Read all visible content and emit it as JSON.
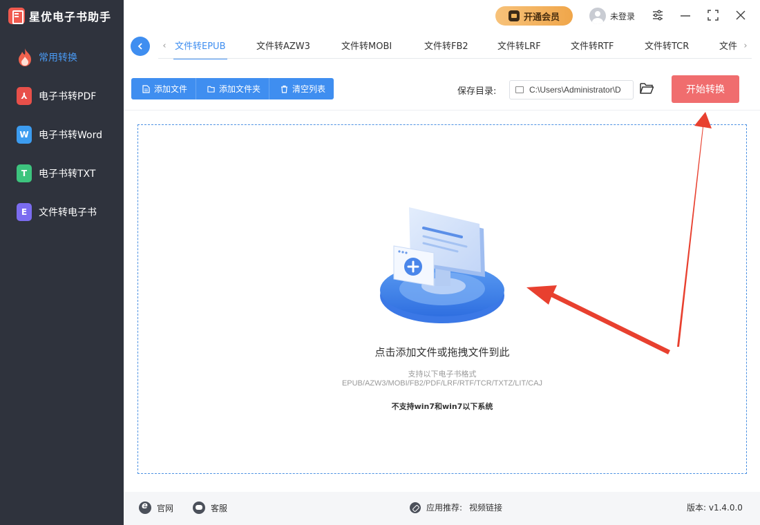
{
  "app": {
    "title": "星优电子书助手"
  },
  "sidebar": {
    "items": [
      {
        "label": "常用转换",
        "icon": "fire-icon",
        "active": true
      },
      {
        "label": "电子书转PDF",
        "icon": "pdf-icon",
        "glyph": "⅄",
        "color": "#e8504a"
      },
      {
        "label": "电子书转Word",
        "icon": "word-icon",
        "glyph": "W",
        "color": "#3c9cf0"
      },
      {
        "label": "电子书转TXT",
        "icon": "txt-icon",
        "glyph": "T",
        "color": "#3dc47e"
      },
      {
        "label": "文件转电子书",
        "icon": "ebook-icon",
        "glyph": "E",
        "color": "#7b6cf0"
      }
    ]
  },
  "titlebar": {
    "vip_label": "开通会员",
    "user_label": "未登录"
  },
  "tabs": [
    {
      "label": "文件转EPUB",
      "active": true
    },
    {
      "label": "文件转AZW3"
    },
    {
      "label": "文件转MOBI"
    },
    {
      "label": "文件转FB2"
    },
    {
      "label": "文件转LRF"
    },
    {
      "label": "文件转RTF"
    },
    {
      "label": "文件转TCR"
    },
    {
      "label": "文件"
    }
  ],
  "toolbar": {
    "add_file": "添加文件",
    "add_folder": "添加文件夹",
    "clear_list": "清空列表",
    "save_dir_label": "保存目录:",
    "save_dir_value": "C:\\Users\\Administrator\\D",
    "start_label": "开始转换"
  },
  "dropzone": {
    "title": "点击添加文件或拖拽文件到此",
    "subtitle": "支持以下电子书格式",
    "formats": "EPUB/AZW3/MOBI/FB2/PDF/LRF/RTF/TCR/TXTZ/LIT/CAJ",
    "warning": "不支持win7和win7以下系统"
  },
  "footer": {
    "website": "官网",
    "support": "客服",
    "recommend_label": "应用推荐:",
    "recommend_value": "视频链接",
    "version": "版本: v1.4.0.0"
  },
  "colors": {
    "accent": "#3f8ef0",
    "start_button": "#f06d6e",
    "sidebar_bg": "#2f333d",
    "annotation_arrow": "#e8402f"
  }
}
